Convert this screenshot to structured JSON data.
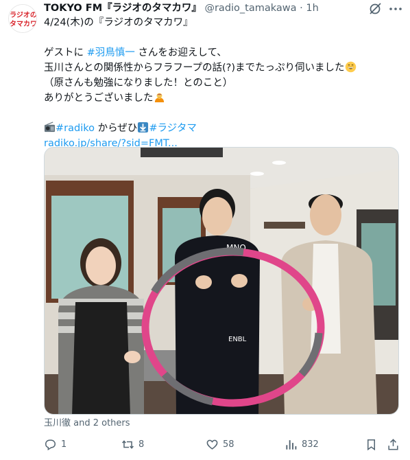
{
  "author": {
    "name": "TOKYO FM『ラジオのタマカワ』",
    "handle": "@radio_tamakawa",
    "separator": "·",
    "time": "1h",
    "avatar_text": [
      "ラジオの",
      "タマカワ"
    ]
  },
  "post": {
    "line1": "4/24(木)の『ラジオのタマカワ』",
    "line2_prefix": "ゲストに ",
    "line2_hashtag": "#羽鳥慎一",
    "line2_suffix": " さんをお迎えして、",
    "line3": "玉川さんとの関係性からフラフープの話(?)までたっぷり伺いました",
    "line4": "（原さんも勉強になりました！とのこと）",
    "line5": "ありがとうございました",
    "line6_hashtag1": "#radiko",
    "line6_middle": " からぜひ",
    "line6_hashtag2": "#ラジタマ",
    "line7_link": "radiko.jp/share/?sid=FMT..."
  },
  "media": {
    "tagged": "玉川徹 and 2 others"
  },
  "actions": {
    "reply_count": "1",
    "repost_count": "8",
    "like_count": "58",
    "view_count": "832"
  },
  "icons": {
    "grok": "grok-icon",
    "more": "more-icon",
    "reply": "reply-icon",
    "repost": "repost-icon",
    "like": "heart-icon",
    "views": "bar-chart-icon",
    "bookmark": "bookmark-icon",
    "share": "share-icon"
  },
  "colors": {
    "link": "#1d9bf0",
    "text": "#0f1419",
    "secondary": "#536471",
    "brand_red": "#d8232a"
  }
}
